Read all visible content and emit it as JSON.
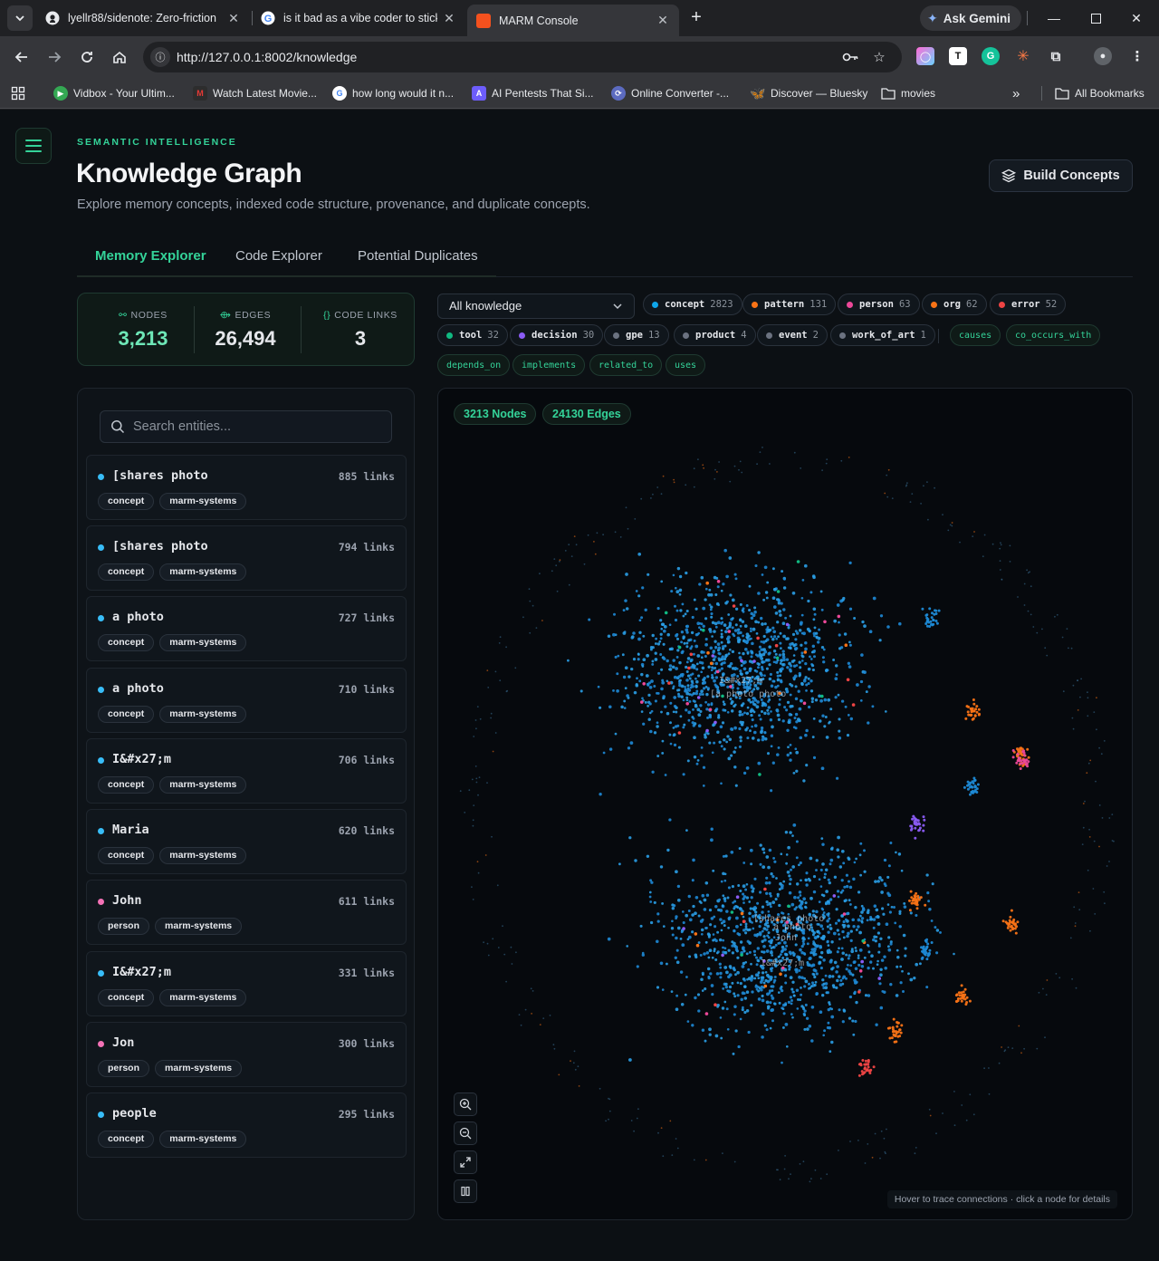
{
  "browser": {
    "tabs": [
      {
        "title": "lyellr88/sidenote: Zero-friction",
        "icon": "github-icon"
      },
      {
        "title": "is it bad as a vibe coder to stick",
        "icon": "google-icon"
      },
      {
        "title": "MARM Console",
        "icon": "marm-icon"
      }
    ],
    "ask_gemini": "Ask Gemini",
    "url": "http://127.0.0.1:8002/knowledge",
    "bookmarks": [
      {
        "label": "Vidbox - Your Ultim..."
      },
      {
        "label": "Watch Latest Movie..."
      },
      {
        "label": "how long would it n..."
      },
      {
        "label": "AI Pentests That Si..."
      },
      {
        "label": "Online Converter -..."
      },
      {
        "label": "Discover — Bluesky"
      },
      {
        "label": "movies"
      }
    ],
    "all_bookmarks": "All Bookmarks"
  },
  "header": {
    "eyebrow": "SEMANTIC INTELLIGENCE",
    "title": "Knowledge Graph",
    "subtitle": "Explore memory concepts, indexed code structure, provenance, and duplicate concepts.",
    "build_button": "Build Concepts"
  },
  "tabs": [
    "Memory Explorer",
    "Code Explorer",
    "Potential Duplicates"
  ],
  "stats": {
    "nodes_label": "NODES",
    "nodes": "3,213",
    "edges_label": "EDGES",
    "edges": "26,494",
    "code_links_label": "CODE LINKS",
    "code_links": "3"
  },
  "search": {
    "placeholder": "Search entities..."
  },
  "entities": [
    {
      "name": "[shares photo",
      "links": "885 links",
      "type": "concept",
      "source": "marm-systems",
      "color": "#38bdf8"
    },
    {
      "name": "[shares photo",
      "links": "794 links",
      "type": "concept",
      "source": "marm-systems",
      "color": "#38bdf8"
    },
    {
      "name": "a photo",
      "links": "727 links",
      "type": "concept",
      "source": "marm-systems",
      "color": "#38bdf8"
    },
    {
      "name": "a photo",
      "links": "710 links",
      "type": "concept",
      "source": "marm-systems",
      "color": "#38bdf8"
    },
    {
      "name": "I&#x27;m",
      "links": "706 links",
      "type": "concept",
      "source": "marm-systems",
      "color": "#38bdf8"
    },
    {
      "name": "Maria",
      "links": "620 links",
      "type": "concept",
      "source": "marm-systems",
      "color": "#38bdf8"
    },
    {
      "name": "John",
      "links": "611 links",
      "type": "person",
      "source": "marm-systems",
      "color": "#f472b6"
    },
    {
      "name": "I&#x27;m",
      "links": "331 links",
      "type": "concept",
      "source": "marm-systems",
      "color": "#38bdf8"
    },
    {
      "name": "Jon",
      "links": "300 links",
      "type": "person",
      "source": "marm-systems",
      "color": "#f472b6"
    },
    {
      "name": "people",
      "links": "295 links",
      "type": "concept",
      "source": "marm-systems",
      "color": "#38bdf8"
    }
  ],
  "filter": {
    "selected": "All knowledge",
    "types": [
      {
        "name": "concept",
        "count": "2823",
        "color": "#0ea5e9"
      },
      {
        "name": "pattern",
        "count": "131",
        "color": "#f97316"
      },
      {
        "name": "person",
        "count": "63",
        "color": "#ec4899"
      },
      {
        "name": "org",
        "count": "62",
        "color": "#f97316"
      },
      {
        "name": "error",
        "count": "52",
        "color": "#ef4444"
      },
      {
        "name": "tool",
        "count": "32",
        "color": "#10b981"
      },
      {
        "name": "decision",
        "count": "30",
        "color": "#8b5cf6"
      },
      {
        "name": "gpe",
        "count": "13",
        "color": "#6b7280"
      },
      {
        "name": "product",
        "count": "4",
        "color": "#6b7280"
      },
      {
        "name": "event",
        "count": "2",
        "color": "#6b7280"
      },
      {
        "name": "work_of_art",
        "count": "1",
        "color": "#6b7280"
      }
    ],
    "relations": [
      "causes",
      "co_occurs_with",
      "depends_on",
      "implements",
      "related_to",
      "uses"
    ]
  },
  "graph": {
    "nodes_badge": "3213 Nodes",
    "edges_badge": "24130 Edges",
    "labels": [
      "I&#x27;m",
      "[a photo photo",
      "[shares photo",
      "a photo",
      "John",
      "I&#x27;m"
    ],
    "hint": "Hover to trace connections · click a node for details"
  }
}
